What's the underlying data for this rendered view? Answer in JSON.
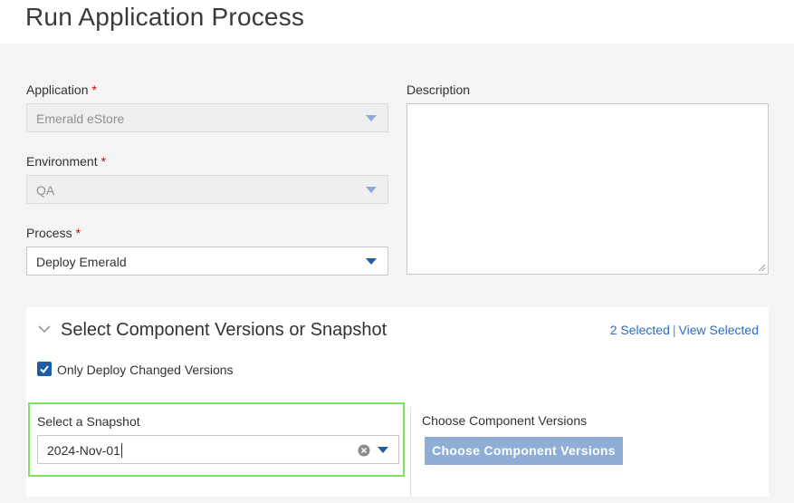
{
  "header": {
    "title": "Run Application Process"
  },
  "form": {
    "application": {
      "label": "Application",
      "required_mark": "*",
      "value": "Emerald eStore"
    },
    "environment": {
      "label": "Environment",
      "required_mark": "*",
      "value": "QA"
    },
    "process": {
      "label": "Process",
      "required_mark": "*",
      "value": "Deploy Emerald"
    },
    "description": {
      "label": "Description",
      "value": ""
    }
  },
  "versions_panel": {
    "title": "Select Component Versions or Snapshot",
    "selected_count": "2 Selected",
    "separator": "|",
    "view_selected": "View Selected",
    "only_changed": {
      "label": "Only Deploy Changed Versions",
      "checked": true
    },
    "snapshot": {
      "label": "Select a Snapshot",
      "value": "2024-Nov-01"
    },
    "component_versions": {
      "label": "Choose Component Versions",
      "button": "Choose Component Versions"
    }
  },
  "colors": {
    "accent": "#1f5ba6",
    "link": "#2d6dba",
    "required": "#d0021b",
    "highlight": "#80e060",
    "button_disabled": "#8eaed6"
  },
  "icons": [
    "chevron-down-icon",
    "checkmark-icon",
    "clear-icon",
    "caret-down-icon",
    "resize-grip-icon"
  ]
}
